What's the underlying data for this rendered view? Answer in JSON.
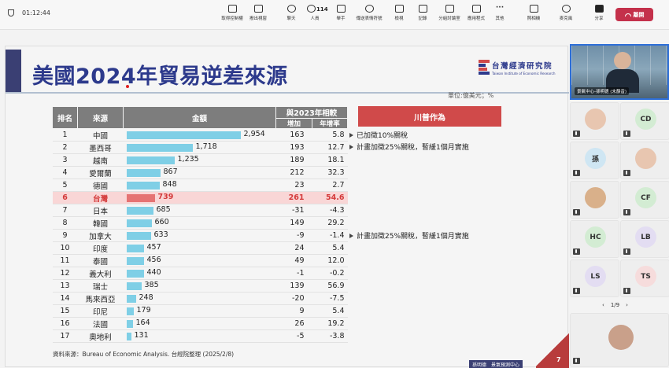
{
  "meeting": {
    "timer": "01:12:44",
    "toolbar": [
      {
        "label": "取得控制權",
        "icon": "control-icon"
      },
      {
        "label": "撥出視窗",
        "icon": "popout-icon"
      },
      {
        "label": "聊天",
        "icon": "chat-icon"
      },
      {
        "label": "人員",
        "icon": "people-icon",
        "count": "114"
      },
      {
        "label": "舉手",
        "icon": "raise-hand-icon"
      },
      {
        "label": "傳送表情符號",
        "icon": "emoji-icon"
      },
      {
        "label": "檢視",
        "icon": "view-icon"
      },
      {
        "label": "記錄",
        "icon": "notes-icon"
      },
      {
        "label": "分組討論室",
        "icon": "breakout-icon"
      },
      {
        "label": "應用程式",
        "icon": "apps-icon"
      },
      {
        "label": "其他",
        "icon": "more-icon"
      },
      {
        "label": "照相機",
        "icon": "camera-off-icon"
      },
      {
        "label": "麥克風",
        "icon": "mic-off-icon"
      },
      {
        "label": "分享",
        "icon": "share-icon"
      }
    ],
    "leave_label": "離開"
  },
  "slide": {
    "title": "美國2024年貿易逆差來源",
    "logo_main": "台灣經濟研究院",
    "logo_sub": "Taiwan Institute of Economic Research",
    "unit": "單位:億美元；%",
    "headers": {
      "rank": "排名",
      "country": "來源",
      "amount": "金額",
      "compare": "與2023年相較",
      "increase": "增加",
      "growth": "年增率",
      "trump": "川普作為"
    },
    "rows": [
      {
        "rank": "1",
        "country": "中國",
        "amount": "2,954",
        "value": 2954,
        "increase": "163",
        "growth": "5.8"
      },
      {
        "rank": "2",
        "country": "墨西哥",
        "amount": "1,718",
        "value": 1718,
        "increase": "193",
        "growth": "12.7"
      },
      {
        "rank": "3",
        "country": "越南",
        "amount": "1,235",
        "value": 1235,
        "increase": "189",
        "growth": "18.1"
      },
      {
        "rank": "4",
        "country": "愛爾蘭",
        "amount": "867",
        "value": 867,
        "increase": "212",
        "growth": "32.3"
      },
      {
        "rank": "5",
        "country": "德國",
        "amount": "848",
        "value": 848,
        "increase": "23",
        "growth": "2.7"
      },
      {
        "rank": "6",
        "country": "台灣",
        "amount": "739",
        "value": 739,
        "increase": "261",
        "growth": "54.6"
      },
      {
        "rank": "7",
        "country": "日本",
        "amount": "685",
        "value": 685,
        "increase": "-31",
        "growth": "-4.3"
      },
      {
        "rank": "8",
        "country": "韓國",
        "amount": "660",
        "value": 660,
        "increase": "149",
        "growth": "29.2"
      },
      {
        "rank": "9",
        "country": "加拿大",
        "amount": "633",
        "value": 633,
        "increase": "-9",
        "growth": "-1.4"
      },
      {
        "rank": "10",
        "country": "印度",
        "amount": "457",
        "value": 457,
        "increase": "24",
        "growth": "5.4"
      },
      {
        "rank": "11",
        "country": "泰國",
        "amount": "456",
        "value": 456,
        "increase": "49",
        "growth": "12.0"
      },
      {
        "rank": "12",
        "country": "義大利",
        "amount": "440",
        "value": 440,
        "increase": "-1",
        "growth": "-0.2"
      },
      {
        "rank": "13",
        "country": "瑞士",
        "amount": "385",
        "value": 385,
        "increase": "139",
        "growth": "56.9"
      },
      {
        "rank": "14",
        "country": "馬來西亞",
        "amount": "248",
        "value": 248,
        "increase": "-20",
        "growth": "-7.5"
      },
      {
        "rank": "15",
        "country": "印尼",
        "amount": "179",
        "value": 179,
        "increase": "9",
        "growth": "5.4"
      },
      {
        "rank": "16",
        "country": "法國",
        "amount": "164",
        "value": 164,
        "increase": "26",
        "growth": "19.2"
      },
      {
        "rank": "17",
        "country": "奧地利",
        "amount": "131",
        "value": 131,
        "increase": "-5",
        "growth": "-3.8"
      }
    ],
    "notes": [
      {
        "text": "已加徵10%關稅"
      },
      {
        "text": "計畫加徵25%關稅，暫緩1個月實施"
      },
      {
        "text": "計畫加徵25%關稅，暫緩1個月實施"
      }
    ],
    "source": "資料來源：Bureau of Economic Analysis. 台經院整理 (2025/2/8)",
    "footer_left": "孫明德",
    "footer_right": "景氣預測中心",
    "page": "7",
    "highlight_color": "#d43a3a",
    "bar_color": "#7fcfe6"
  },
  "participants": {
    "presenter_label": "景氣中心-孫明德 (未靜音)",
    "tiles": [
      {
        "initials": "",
        "kind": "photo"
      },
      {
        "initials": "CD",
        "color": "#d3ecd3"
      },
      {
        "initials": "孫",
        "color": "#cfe6f3"
      },
      {
        "initials": "",
        "kind": "photo"
      },
      {
        "initials": "",
        "kind": "photo"
      },
      {
        "initials": "CF",
        "color": "#d3ecd3"
      },
      {
        "initials": "HC",
        "color": "#d3ecd3"
      },
      {
        "initials": "LB",
        "color": "#e3ddf2"
      },
      {
        "initials": "LS",
        "color": "#e3ddf2"
      },
      {
        "initials": "TS",
        "color": "#f6dcdc"
      }
    ],
    "pager": "1/9"
  }
}
